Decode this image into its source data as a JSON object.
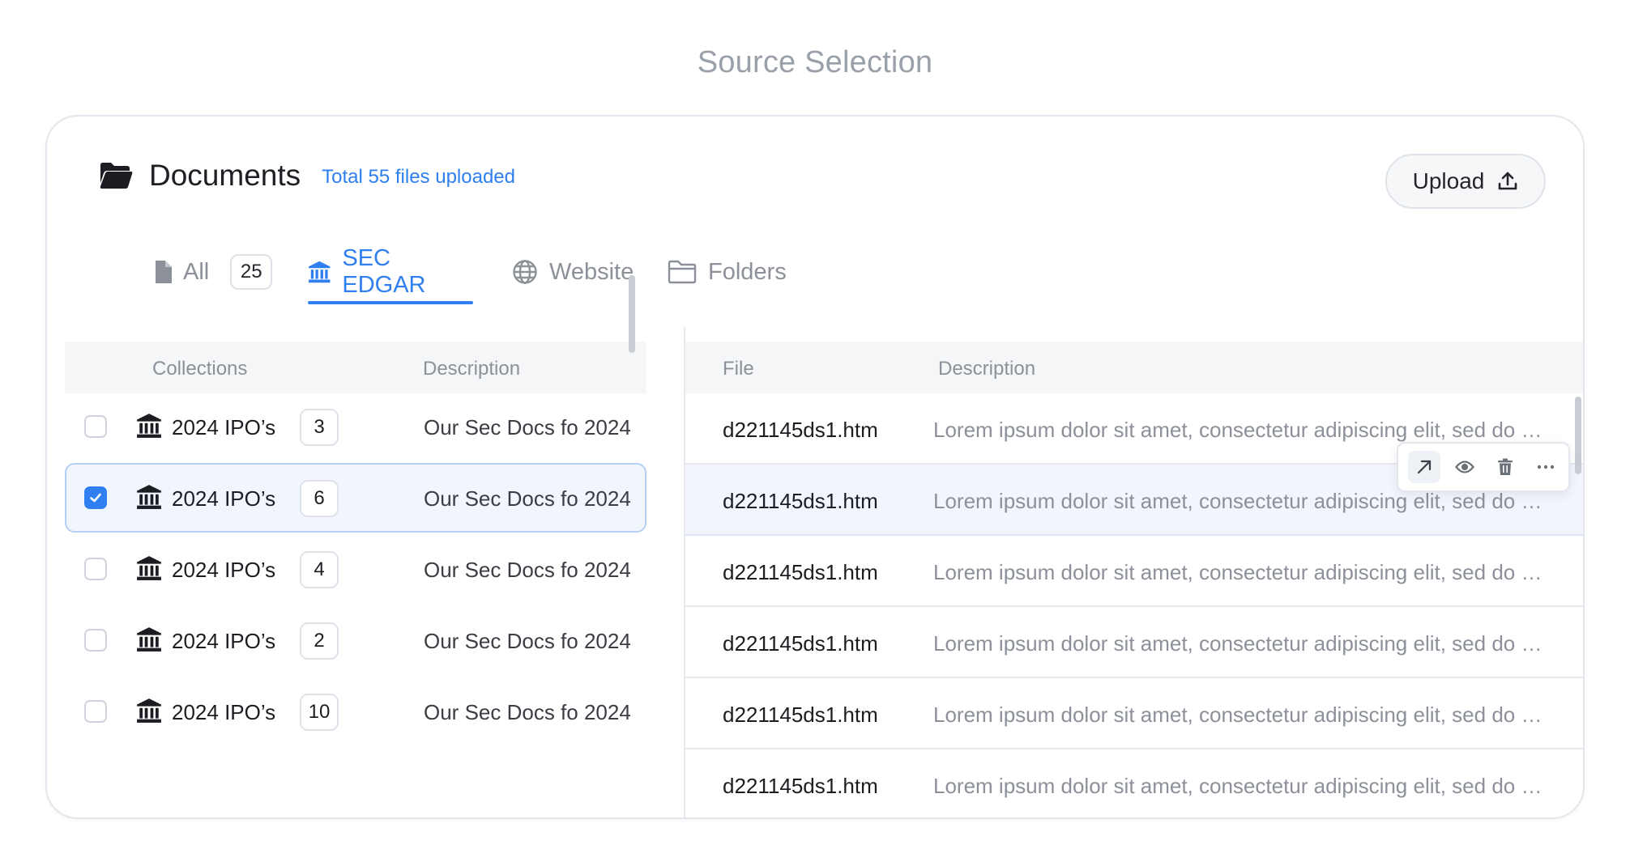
{
  "page": {
    "title": "Source Selection"
  },
  "header": {
    "title": "Documents",
    "total": "Total 55 files uploaded",
    "upload_label": "Upload"
  },
  "tabs": [
    {
      "label": "All",
      "count": "25",
      "icon": "file-icon",
      "active": false
    },
    {
      "label": "SEC EDGAR",
      "icon": "bank-icon",
      "active": true
    },
    {
      "label": "Website",
      "icon": "globe-icon",
      "active": false
    },
    {
      "label": "Folders",
      "icon": "folder-icon",
      "active": false
    }
  ],
  "collections": {
    "columns": {
      "name": "Collections",
      "description": "Description"
    },
    "rows": [
      {
        "name": "2024 IPO’s",
        "count": "3",
        "description": "Our Sec Docs fo 2024",
        "checked": false
      },
      {
        "name": "2024 IPO’s",
        "count": "6",
        "description": "Our Sec Docs fo 2024",
        "checked": true
      },
      {
        "name": "2024 IPO’s",
        "count": "4",
        "description": "Our Sec Docs fo 2024",
        "checked": false
      },
      {
        "name": "2024 IPO’s",
        "count": "2",
        "description": "Our Sec Docs fo 2024",
        "checked": false
      },
      {
        "name": "2024 IPO’s",
        "count": "10",
        "description": "Our Sec Docs fo 2024",
        "checked": false
      }
    ]
  },
  "files": {
    "columns": {
      "file": "File",
      "description": "Description"
    },
    "rows": [
      {
        "name": "d221145ds1.htm",
        "description": "Lorem ipsum dolor sit amet, consectetur adipiscing elit, sed do eiusmod tempor"
      },
      {
        "name": "d221145ds1.htm",
        "description": "Lorem ipsum dolor sit amet, consectetur adipiscing elit, sed do eiusmod tempor"
      },
      {
        "name": "d221145ds1.htm",
        "description": "Lorem ipsum dolor sit amet, consectetur adipiscing elit, sed do eiusmod tempor"
      },
      {
        "name": "d221145ds1.htm",
        "description": "Lorem ipsum dolor sit amet, consectetur adipiscing elit, sed do eiusmod tempor"
      },
      {
        "name": "d221145ds1.htm",
        "description": "Lorem ipsum dolor sit amet, consectetur adipiscing elit, sed do eiusmod tempor"
      },
      {
        "name": "d221145ds1.htm",
        "description": "Lorem ipsum dolor sit amet, consectetur adipiscing elit, sed do eiusmod tempor"
      }
    ]
  },
  "row_actions": [
    "open-external-icon",
    "eye-icon",
    "trash-icon",
    "more-icon"
  ],
  "colors": {
    "accent": "#2f7ff0",
    "muted": "#8b9099",
    "border": "#e3e6ec"
  }
}
